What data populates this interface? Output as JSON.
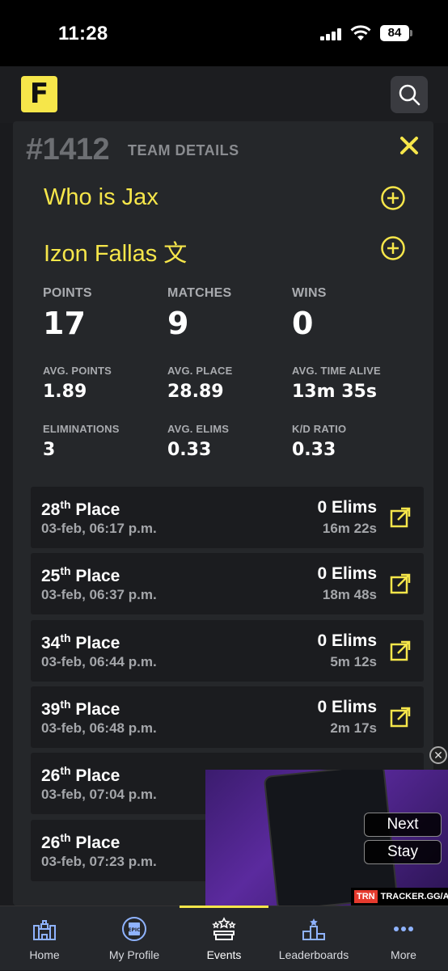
{
  "status_bar": {
    "time": "11:28",
    "battery": "84"
  },
  "header": {
    "logo_letter": "F"
  },
  "team": {
    "rank": "#1412",
    "details_label": "TEAM DETAILS",
    "players": [
      {
        "name": "Who is Jax"
      },
      {
        "name": "Izon Fallas 文"
      }
    ]
  },
  "stats": {
    "points": {
      "label": "POINTS",
      "value": "17"
    },
    "matches": {
      "label": "MATCHES",
      "value": "9"
    },
    "wins": {
      "label": "WINS",
      "value": "0"
    },
    "avg_points": {
      "label": "AVG. POINTS",
      "value": "1.89"
    },
    "avg_place": {
      "label": "AVG. PLACE",
      "value": "28.89"
    },
    "avg_time_alive": {
      "label": "AVG. TIME ALIVE",
      "value": "13m 35s"
    },
    "eliminations": {
      "label": "ELIMINATIONS",
      "value": "3"
    },
    "avg_elims": {
      "label": "AVG. ELIMS",
      "value": "0.33"
    },
    "kd_ratio": {
      "label": "K/D RATIO",
      "value": "0.33"
    }
  },
  "matches": [
    {
      "place_num": "28",
      "place_suffix": "th",
      "place_word": "Place",
      "date": "03-feb, 06:17 p.m.",
      "elims": "0 Elims",
      "time": "16m 22s"
    },
    {
      "place_num": "25",
      "place_suffix": "th",
      "place_word": "Place",
      "date": "03-feb, 06:37 p.m.",
      "elims": "0 Elims",
      "time": "18m 48s"
    },
    {
      "place_num": "34",
      "place_suffix": "th",
      "place_word": "Place",
      "date": "03-feb, 06:44 p.m.",
      "elims": "0 Elims",
      "time": "5m 12s"
    },
    {
      "place_num": "39",
      "place_suffix": "th",
      "place_word": "Place",
      "date": "03-feb, 06:48 p.m.",
      "elims": "0 Elims",
      "time": "2m 17s"
    },
    {
      "place_num": "26",
      "place_suffix": "th",
      "place_word": "Place",
      "date": "03-feb, 07:04 p.m.",
      "elims": "",
      "time": ""
    },
    {
      "place_num": "26",
      "place_suffix": "th",
      "place_word": "Place",
      "date": "03-feb, 07:23 p.m.",
      "elims": "",
      "time": ""
    }
  ],
  "ad": {
    "next_label": "Next",
    "stay_label": "Stay",
    "brand_badge": "TRN",
    "brand_text": "TRACKER.GG/APPS"
  },
  "tabs": [
    {
      "label": "Home",
      "icon": "castle-icon"
    },
    {
      "label": "My Profile",
      "icon": "epic-badge-icon"
    },
    {
      "label": "Events",
      "icon": "stars-podium-icon"
    },
    {
      "label": "Leaderboards",
      "icon": "podium-icon"
    },
    {
      "label": "More",
      "icon": "more-dots-icon"
    }
  ],
  "colors": {
    "accent": "#f6e64a",
    "panel": "#25272a",
    "card": "#1b1c1f",
    "background": "#1c1d20"
  }
}
